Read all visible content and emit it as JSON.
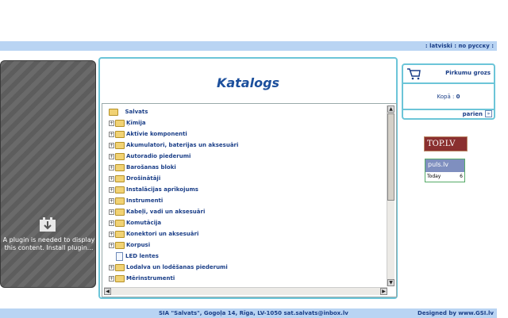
{
  "header": {
    "languages": ": latviski : по русску :"
  },
  "plugin": {
    "message": "A plugin is needed to display this content. Install plugin...",
    "icon": "plugin-download-icon"
  },
  "catalog": {
    "title": "Katalogs",
    "root": "Salvats",
    "items": [
      "Ķīmija",
      "Aktīvie komponenti",
      "Akumulatori, baterijas un aksesuāri",
      "Autoradio piederumi",
      "Barošanas bloki",
      "Drošinātāji",
      "Instalācijas aprīkojums",
      "Instrumenti",
      "Kabeļi, vadi un aksesuāri",
      "Komutācija",
      "Konektori un aksesuāri",
      "Korpusi",
      "LED lentes",
      "Lodalva un lodēšanas piederumi",
      "Mērinstrumenti"
    ]
  },
  "cart": {
    "title": "Pirkumu grozs",
    "total_label": "Kopā :",
    "total_value": "0",
    "more_label": "parien"
  },
  "badges": {
    "top": "TOP.LV",
    "puls": "puls.lv",
    "puls_day": "Today",
    "puls_count": "6"
  },
  "footer": {
    "text": "SIA \"Salvats\", Gogoļa 14, Rīga, LV-1050 sat.salvats@inbox.lv",
    "designed": "Designed by www.GSI.lv"
  },
  "colors": {
    "bar": "#b9d4f3",
    "accent": "#6cc5d8",
    "link": "#1b3f88"
  }
}
